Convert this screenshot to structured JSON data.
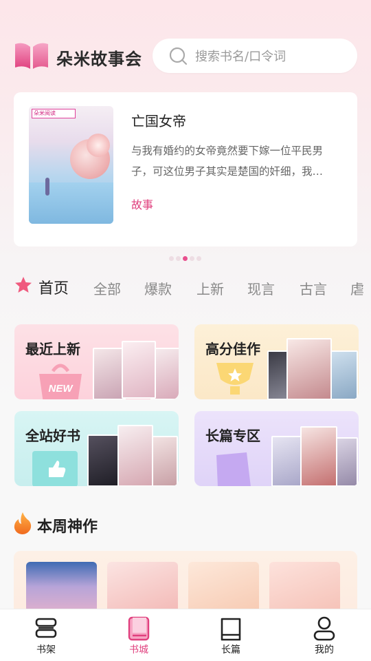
{
  "app": {
    "title": "朵米故事会"
  },
  "search": {
    "placeholder": "搜索书名/口令词"
  },
  "featured": {
    "title": "亡国女帝",
    "description": "与我有婚约的女帝竟然要下嫁一位平民男子，可这位男子其实是楚国的奸细，我…",
    "tag": "故事",
    "cover_brand": "朵米阅读"
  },
  "carousel": {
    "count": 5,
    "active_index": 2
  },
  "tabs": [
    {
      "label": "首页",
      "active": true
    },
    {
      "label": "全部",
      "active": false
    },
    {
      "label": "爆款",
      "active": false
    },
    {
      "label": "上新",
      "active": false
    },
    {
      "label": "现言",
      "active": false
    },
    {
      "label": "古言",
      "active": false
    },
    {
      "label": "虐",
      "active": false
    }
  ],
  "categories": [
    {
      "label": "最近上新",
      "badge": "NEW"
    },
    {
      "label": "高分佳作"
    },
    {
      "label": "全站好书"
    },
    {
      "label": "长篇专区"
    }
  ],
  "weekly": {
    "title": "本周神作"
  },
  "bottom_nav": [
    {
      "label": "书架",
      "active": false
    },
    {
      "label": "书城",
      "active": true
    },
    {
      "label": "长篇",
      "active": false
    },
    {
      "label": "我的",
      "active": false
    }
  ],
  "colors": {
    "accent": "#e0407e",
    "brand": "#e8508e"
  }
}
